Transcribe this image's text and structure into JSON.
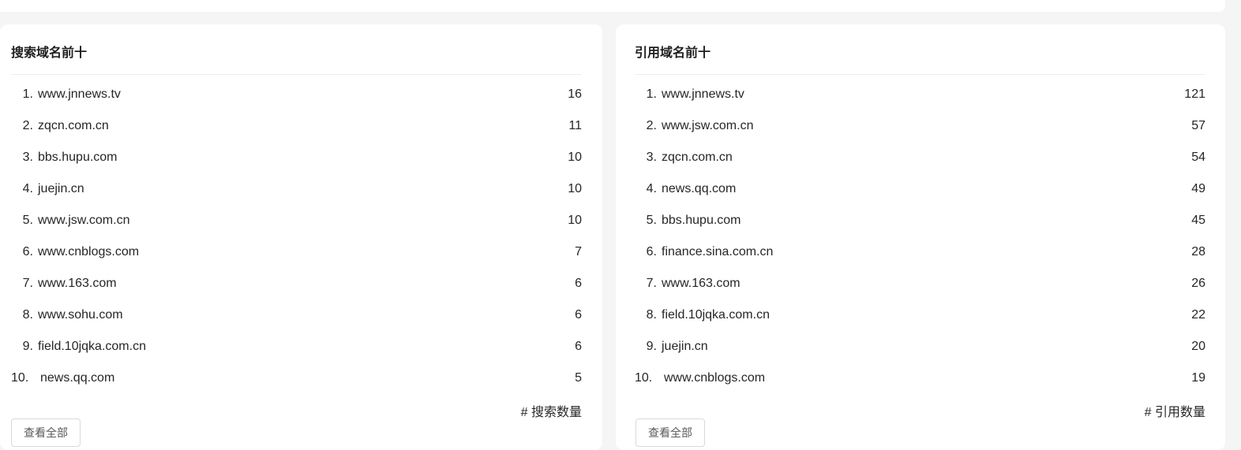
{
  "search_panel": {
    "title": "搜索域名前十",
    "metric_label": "# 搜索数量",
    "view_all_label": "查看全部",
    "items": [
      {
        "rank": "1.",
        "domain": "www.jnnews.tv",
        "count": "16"
      },
      {
        "rank": "2.",
        "domain": "zqcn.com.cn",
        "count": "11"
      },
      {
        "rank": "3.",
        "domain": "bbs.hupu.com",
        "count": "10"
      },
      {
        "rank": "4.",
        "domain": "juejin.cn",
        "count": "10"
      },
      {
        "rank": "5.",
        "domain": "www.jsw.com.cn",
        "count": "10"
      },
      {
        "rank": "6.",
        "domain": "www.cnblogs.com",
        "count": "7"
      },
      {
        "rank": "7.",
        "domain": "www.163.com",
        "count": "6"
      },
      {
        "rank": "8.",
        "domain": "www.sohu.com",
        "count": "6"
      },
      {
        "rank": "9.",
        "domain": "field.10jqka.com.cn",
        "count": "6"
      },
      {
        "rank": "10.",
        "domain": "news.qq.com",
        "count": "5"
      }
    ]
  },
  "citation_panel": {
    "title": "引用域名前十",
    "metric_label": "# 引用数量",
    "view_all_label": "查看全部",
    "items": [
      {
        "rank": "1.",
        "domain": "www.jnnews.tv",
        "count": "121"
      },
      {
        "rank": "2.",
        "domain": "www.jsw.com.cn",
        "count": "57"
      },
      {
        "rank": "3.",
        "domain": "zqcn.com.cn",
        "count": "54"
      },
      {
        "rank": "4.",
        "domain": "news.qq.com",
        "count": "49"
      },
      {
        "rank": "5.",
        "domain": "bbs.hupu.com",
        "count": "45"
      },
      {
        "rank": "6.",
        "domain": "finance.sina.com.cn",
        "count": "28"
      },
      {
        "rank": "7.",
        "domain": "www.163.com",
        "count": "26"
      },
      {
        "rank": "8.",
        "domain": "field.10jqka.com.cn",
        "count": "22"
      },
      {
        "rank": "9.",
        "domain": "juejin.cn",
        "count": "20"
      },
      {
        "rank": "10.",
        "domain": "www.cnblogs.com",
        "count": "19"
      }
    ]
  }
}
